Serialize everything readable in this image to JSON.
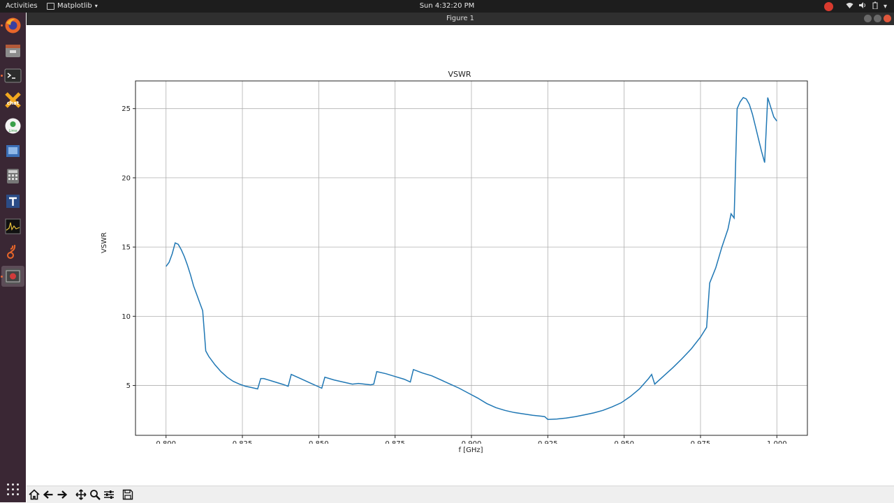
{
  "topbar": {
    "activities": "Activities",
    "app_menu": "Matplotlib",
    "clock": "Sun  4:32:20 PM"
  },
  "window": {
    "title": "Figure 1"
  },
  "dock": {
    "items": [
      "firefox-icon",
      "files-icon",
      "terminal-icon",
      "xchat-icon",
      "lime-icon",
      "virtualbox-icon",
      "calculator-icon",
      "qt-designer-icon",
      "gqrx-icon",
      "gnuradio-icon",
      "figure-window-icon"
    ]
  },
  "toolbar": {
    "buttons": [
      "home-icon",
      "back-icon",
      "forward-icon",
      "pan-icon",
      "zoom-icon",
      "configure-subplots-icon",
      "save-icon"
    ]
  },
  "chart_data": {
    "type": "line",
    "title": "VSWR",
    "xlabel": "f [GHz]",
    "ylabel": "VSWR",
    "xlim": [
      0.79,
      1.01
    ],
    "ylim": [
      1.4,
      27.0
    ],
    "xticks": [
      "0.800",
      "0.825",
      "0.850",
      "0.875",
      "0.900",
      "0.925",
      "0.950",
      "0.975",
      "1.000"
    ],
    "yticks": [
      "5",
      "10",
      "15",
      "20",
      "25"
    ],
    "grid": true,
    "color": "#1f77b4",
    "series": [
      {
        "x": [
          0.8,
          0.801,
          0.802,
          0.803,
          0.804,
          0.805,
          0.806,
          0.807,
          0.808,
          0.809,
          0.81,
          0.811,
          0.812,
          0.813,
          0.814,
          0.816,
          0.818,
          0.82,
          0.822,
          0.824,
          0.826,
          0.828,
          0.83,
          0.831,
          0.832,
          0.835,
          0.838,
          0.84,
          0.841,
          0.844,
          0.847,
          0.85,
          0.851,
          0.852,
          0.855,
          0.858,
          0.861,
          0.863,
          0.865,
          0.867,
          0.868,
          0.869,
          0.872,
          0.875,
          0.878,
          0.88,
          0.881,
          0.884,
          0.887,
          0.89,
          0.893,
          0.896,
          0.899,
          0.902,
          0.905,
          0.908,
          0.911,
          0.914,
          0.917,
          0.92,
          0.923,
          0.924,
          0.925,
          0.928,
          0.931,
          0.934,
          0.937,
          0.94,
          0.943,
          0.946,
          0.949,
          0.952,
          0.955,
          0.958,
          0.959,
          0.96,
          0.963,
          0.966,
          0.969,
          0.972,
          0.975,
          0.977,
          0.978,
          0.98,
          0.982,
          0.984,
          0.985,
          0.986,
          0.987,
          0.988,
          0.989,
          0.99,
          0.991,
          0.992,
          0.993,
          0.994,
          0.995,
          0.996,
          0.997,
          0.998,
          0.999,
          1.0
        ],
        "y": [
          13.6,
          13.9,
          14.5,
          15.3,
          15.2,
          14.8,
          14.3,
          13.7,
          13.0,
          12.2,
          11.6,
          11.0,
          10.4,
          7.5,
          7.1,
          6.5,
          6.0,
          5.6,
          5.3,
          5.1,
          4.95,
          4.85,
          4.75,
          5.5,
          5.5,
          5.3,
          5.1,
          4.95,
          5.8,
          5.5,
          5.2,
          4.9,
          4.8,
          5.6,
          5.4,
          5.25,
          5.1,
          5.15,
          5.1,
          5.05,
          5.1,
          6.0,
          5.85,
          5.65,
          5.45,
          5.25,
          6.15,
          5.9,
          5.7,
          5.4,
          5.1,
          4.8,
          4.45,
          4.1,
          3.7,
          3.4,
          3.2,
          3.05,
          2.95,
          2.85,
          2.78,
          2.75,
          2.55,
          2.58,
          2.65,
          2.75,
          2.88,
          3.02,
          3.2,
          3.45,
          3.75,
          4.2,
          4.75,
          5.5,
          5.8,
          5.1,
          5.7,
          6.3,
          6.95,
          7.65,
          8.5,
          9.2,
          12.4,
          13.5,
          15.0,
          16.3,
          17.4,
          17.1,
          25.0,
          25.5,
          25.8,
          25.7,
          25.3,
          24.6,
          23.7,
          22.8,
          21.9,
          21.1,
          25.8,
          25.1,
          24.4,
          24.1
        ]
      }
    ]
  }
}
